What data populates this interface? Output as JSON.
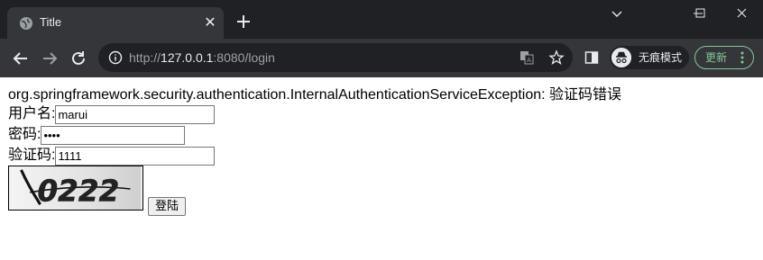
{
  "tab": {
    "title": "Title",
    "close": "✕"
  },
  "address_bar": {
    "scheme": "http://",
    "host": "127.0.0.1",
    "rest": ":8080/login"
  },
  "profile": {
    "label": "无痕模式"
  },
  "update_button": {
    "label": "更新"
  },
  "page": {
    "error_message": "org.springframework.security.authentication.InternalAuthenticationServiceException: 验证码错误",
    "username_label": "用户名:",
    "username_value": "marui",
    "password_label": "密码:",
    "password_value": "••••",
    "code_label": "验证码:",
    "code_value": "1111",
    "captcha_text": "0222",
    "login_button": "登陆"
  },
  "colors": {
    "tabstrip_bg": "#202124",
    "toolbar_bg": "#35363a",
    "omnibox_bg": "#202124",
    "update_accent": "#81c995"
  }
}
